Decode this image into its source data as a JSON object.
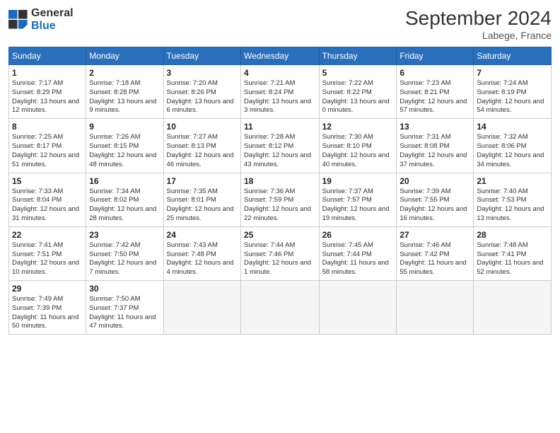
{
  "header": {
    "logo_line1": "General",
    "logo_line2": "Blue",
    "month": "September 2024",
    "location": "Labege, France"
  },
  "weekdays": [
    "Sunday",
    "Monday",
    "Tuesday",
    "Wednesday",
    "Thursday",
    "Friday",
    "Saturday"
  ],
  "weeks": [
    [
      {
        "day": "1",
        "info": "Sunrise: 7:17 AM\nSunset: 8:29 PM\nDaylight: 13 hours and 12 minutes."
      },
      {
        "day": "2",
        "info": "Sunrise: 7:18 AM\nSunset: 8:28 PM\nDaylight: 13 hours and 9 minutes."
      },
      {
        "day": "3",
        "info": "Sunrise: 7:20 AM\nSunset: 8:26 PM\nDaylight: 13 hours and 6 minutes."
      },
      {
        "day": "4",
        "info": "Sunrise: 7:21 AM\nSunset: 8:24 PM\nDaylight: 13 hours and 3 minutes."
      },
      {
        "day": "5",
        "info": "Sunrise: 7:22 AM\nSunset: 8:22 PM\nDaylight: 13 hours and 0 minutes."
      },
      {
        "day": "6",
        "info": "Sunrise: 7:23 AM\nSunset: 8:21 PM\nDaylight: 12 hours and 57 minutes."
      },
      {
        "day": "7",
        "info": "Sunrise: 7:24 AM\nSunset: 8:19 PM\nDaylight: 12 hours and 54 minutes."
      }
    ],
    [
      {
        "day": "8",
        "info": "Sunrise: 7:25 AM\nSunset: 8:17 PM\nDaylight: 12 hours and 51 minutes."
      },
      {
        "day": "9",
        "info": "Sunrise: 7:26 AM\nSunset: 8:15 PM\nDaylight: 12 hours and 48 minutes."
      },
      {
        "day": "10",
        "info": "Sunrise: 7:27 AM\nSunset: 8:13 PM\nDaylight: 12 hours and 46 minutes."
      },
      {
        "day": "11",
        "info": "Sunrise: 7:28 AM\nSunset: 8:12 PM\nDaylight: 12 hours and 43 minutes."
      },
      {
        "day": "12",
        "info": "Sunrise: 7:30 AM\nSunset: 8:10 PM\nDaylight: 12 hours and 40 minutes."
      },
      {
        "day": "13",
        "info": "Sunrise: 7:31 AM\nSunset: 8:08 PM\nDaylight: 12 hours and 37 minutes."
      },
      {
        "day": "14",
        "info": "Sunrise: 7:32 AM\nSunset: 8:06 PM\nDaylight: 12 hours and 34 minutes."
      }
    ],
    [
      {
        "day": "15",
        "info": "Sunrise: 7:33 AM\nSunset: 8:04 PM\nDaylight: 12 hours and 31 minutes."
      },
      {
        "day": "16",
        "info": "Sunrise: 7:34 AM\nSunset: 8:02 PM\nDaylight: 12 hours and 28 minutes."
      },
      {
        "day": "17",
        "info": "Sunrise: 7:35 AM\nSunset: 8:01 PM\nDaylight: 12 hours and 25 minutes."
      },
      {
        "day": "18",
        "info": "Sunrise: 7:36 AM\nSunset: 7:59 PM\nDaylight: 12 hours and 22 minutes."
      },
      {
        "day": "19",
        "info": "Sunrise: 7:37 AM\nSunset: 7:57 PM\nDaylight: 12 hours and 19 minutes."
      },
      {
        "day": "20",
        "info": "Sunrise: 7:39 AM\nSunset: 7:55 PM\nDaylight: 12 hours and 16 minutes."
      },
      {
        "day": "21",
        "info": "Sunrise: 7:40 AM\nSunset: 7:53 PM\nDaylight: 12 hours and 13 minutes."
      }
    ],
    [
      {
        "day": "22",
        "info": "Sunrise: 7:41 AM\nSunset: 7:51 PM\nDaylight: 12 hours and 10 minutes."
      },
      {
        "day": "23",
        "info": "Sunrise: 7:42 AM\nSunset: 7:50 PM\nDaylight: 12 hours and 7 minutes."
      },
      {
        "day": "24",
        "info": "Sunrise: 7:43 AM\nSunset: 7:48 PM\nDaylight: 12 hours and 4 minutes."
      },
      {
        "day": "25",
        "info": "Sunrise: 7:44 AM\nSunset: 7:46 PM\nDaylight: 12 hours and 1 minute."
      },
      {
        "day": "26",
        "info": "Sunrise: 7:45 AM\nSunset: 7:44 PM\nDaylight: 11 hours and 58 minutes."
      },
      {
        "day": "27",
        "info": "Sunrise: 7:46 AM\nSunset: 7:42 PM\nDaylight: 11 hours and 55 minutes."
      },
      {
        "day": "28",
        "info": "Sunrise: 7:48 AM\nSunset: 7:41 PM\nDaylight: 11 hours and 52 minutes."
      }
    ],
    [
      {
        "day": "29",
        "info": "Sunrise: 7:49 AM\nSunset: 7:39 PM\nDaylight: 11 hours and 50 minutes."
      },
      {
        "day": "30",
        "info": "Sunrise: 7:50 AM\nSunset: 7:37 PM\nDaylight: 11 hours and 47 minutes."
      },
      {
        "day": "",
        "info": ""
      },
      {
        "day": "",
        "info": ""
      },
      {
        "day": "",
        "info": ""
      },
      {
        "day": "",
        "info": ""
      },
      {
        "day": "",
        "info": ""
      }
    ]
  ]
}
